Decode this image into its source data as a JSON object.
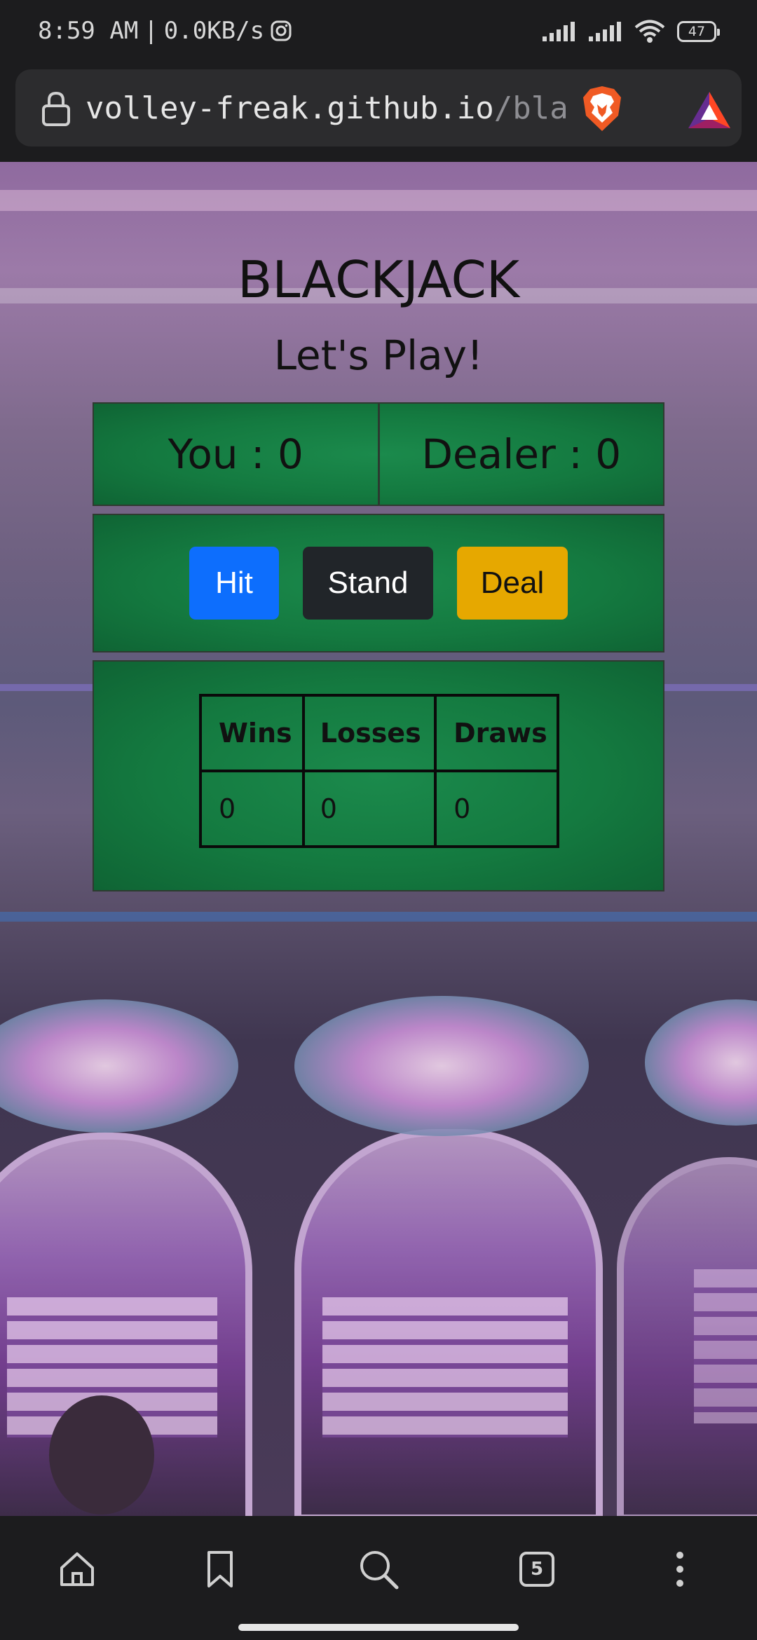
{
  "status_bar": {
    "time": "8:59 AM",
    "network_speed": "0.0KB/s",
    "battery_level": "47",
    "icons": [
      "instagram-icon",
      "signal-icon",
      "signal-icon",
      "wifi-icon",
      "battery-icon"
    ]
  },
  "browser": {
    "url_host": "volley-freak.github.io",
    "url_path": "/bla",
    "icons": [
      "lock-icon",
      "brave-shields-icon",
      "brave-rewards-icon"
    ]
  },
  "game": {
    "title": "BLACKJACK",
    "subtitle": "Let's Play!",
    "you_label": "You : 0",
    "dealer_label": "Dealer : 0",
    "buttons": {
      "hit": "Hit",
      "stand": "Stand",
      "deal": "Deal"
    },
    "stats": {
      "headers": [
        "Wins",
        "Losses",
        "Draws"
      ],
      "values": [
        "0",
        "0",
        "0"
      ]
    }
  },
  "colors": {
    "felt_green": "#147a40",
    "hit_button": "#0d6efd",
    "stand_button": "#212529",
    "deal_button": "#e6a800"
  },
  "bottom_nav": {
    "tab_count": "5",
    "icons": [
      "home-icon",
      "bookmark-icon",
      "search-icon",
      "tabs-icon",
      "more-icon"
    ]
  }
}
